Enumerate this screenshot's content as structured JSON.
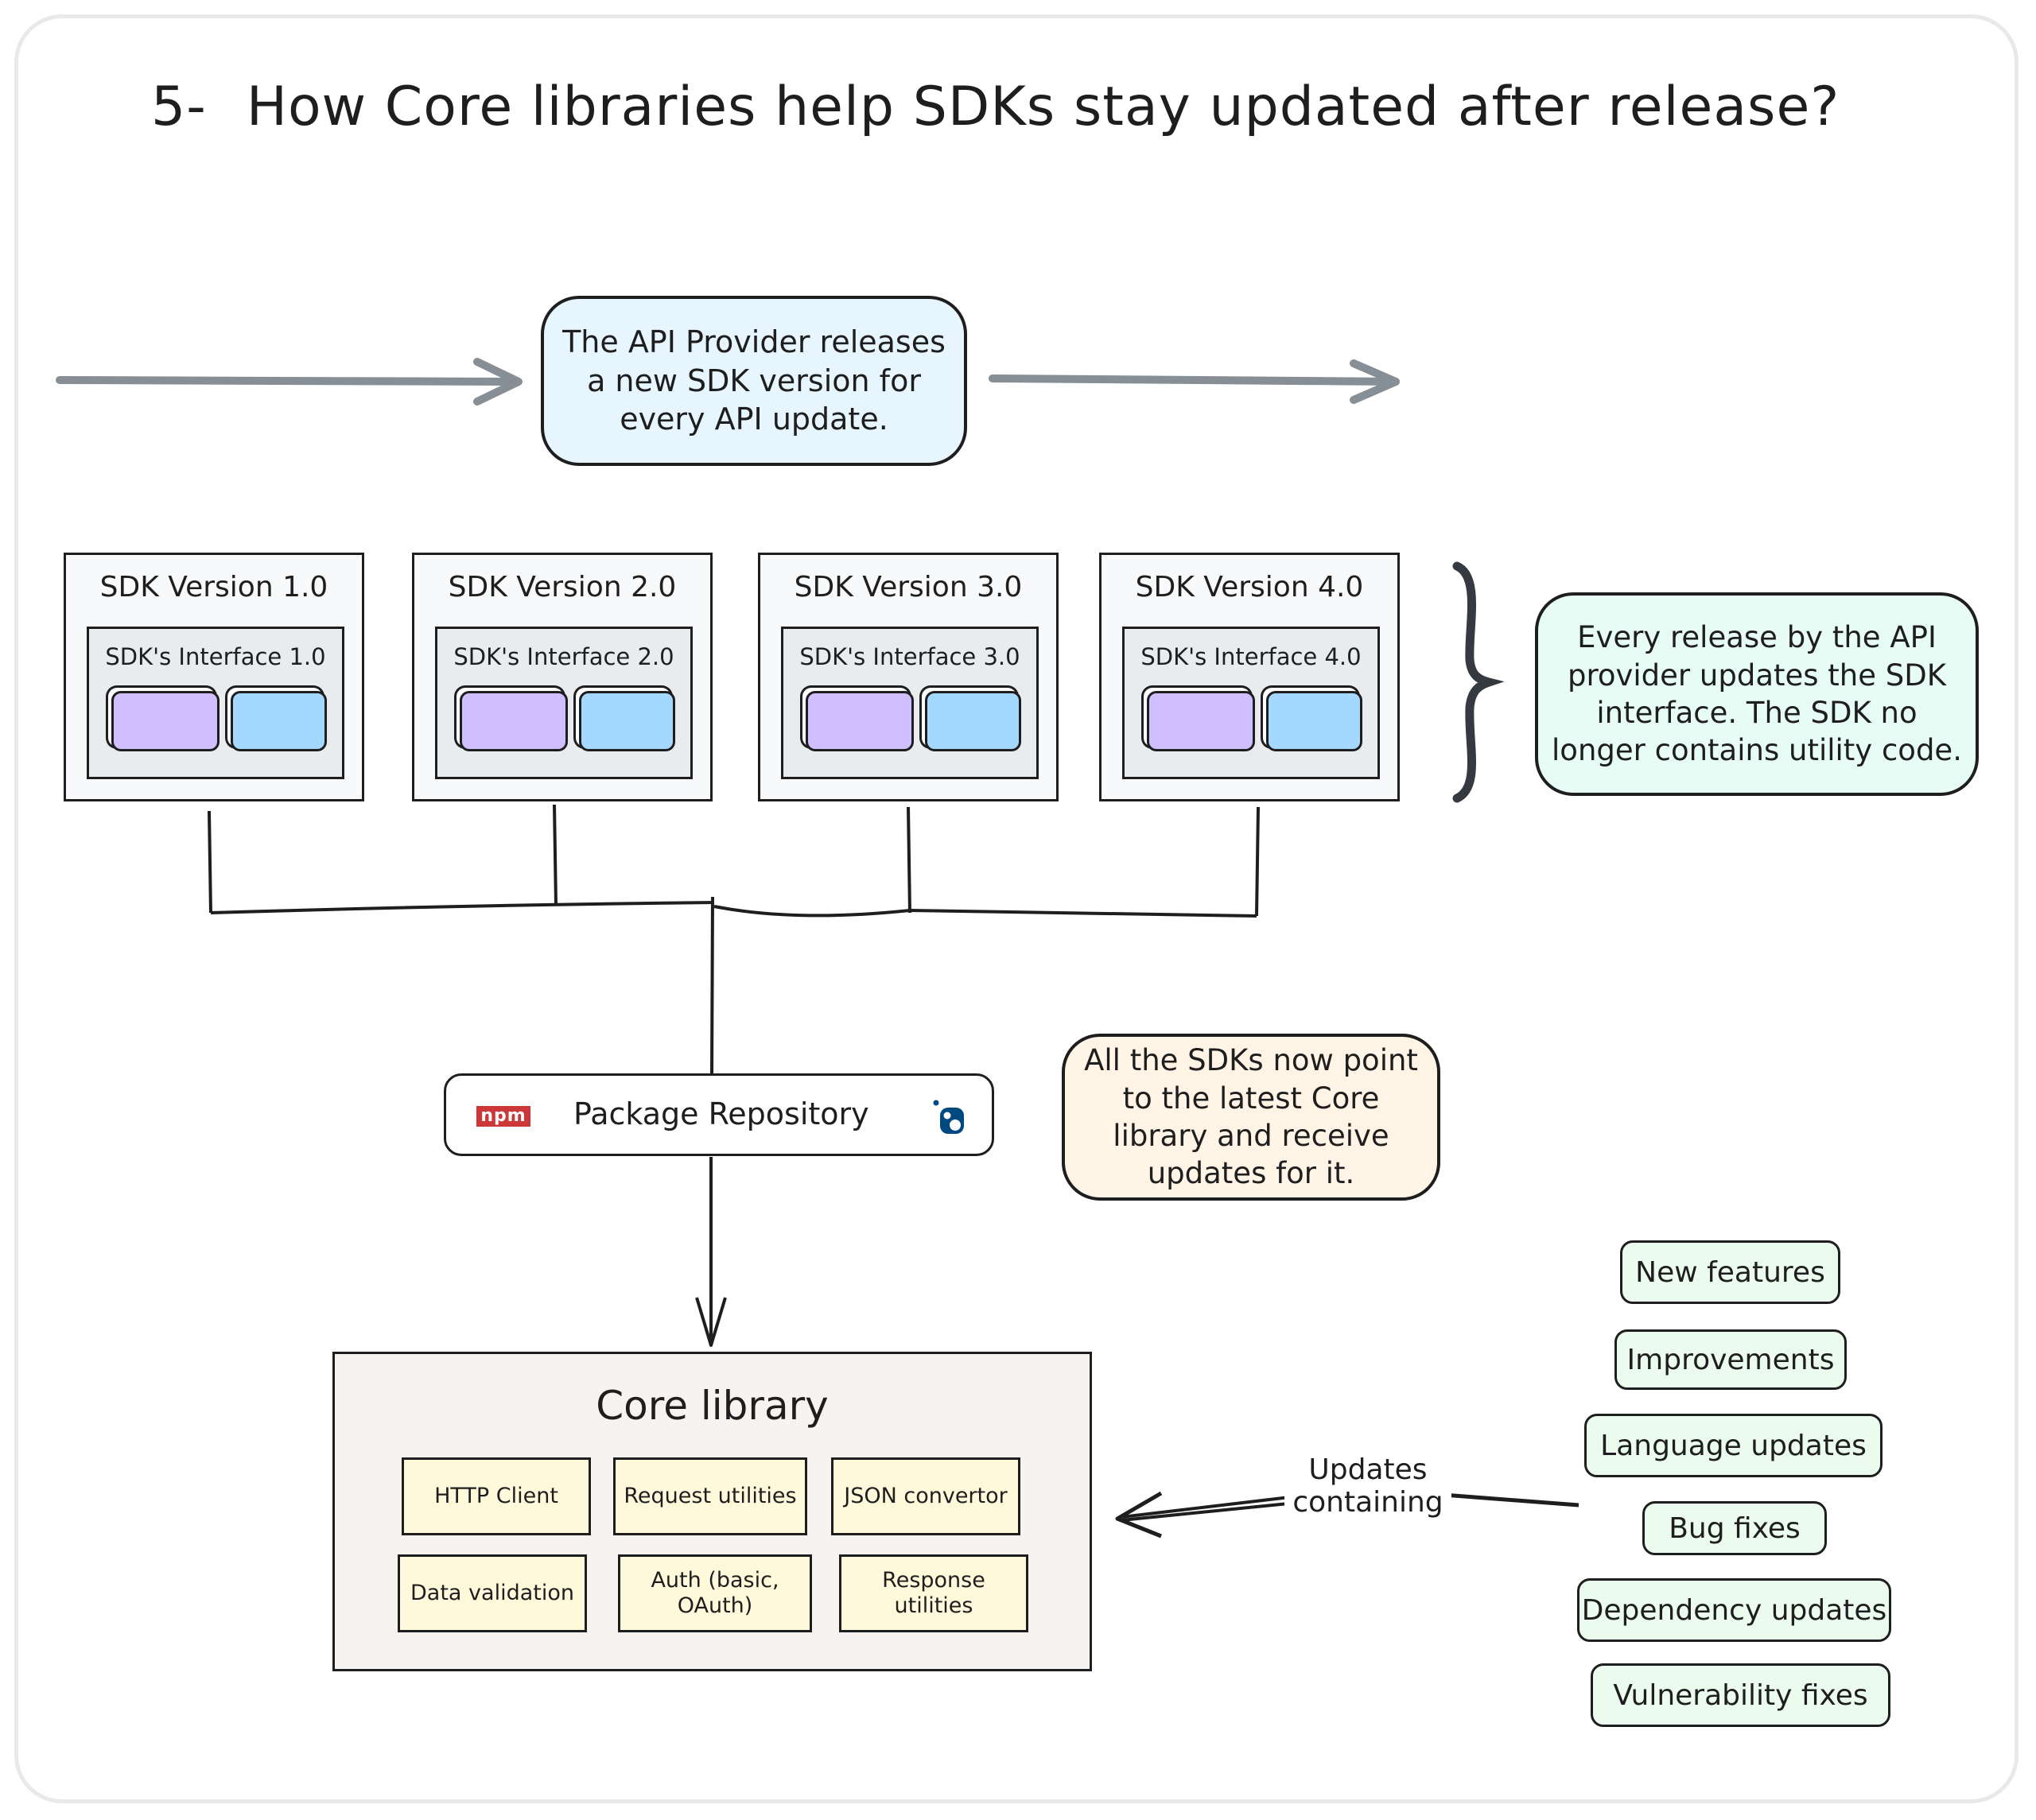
{
  "title": {
    "number": "5-",
    "text": "How Core libraries help SDKs stay updated after release?"
  },
  "release_note": "The API Provider releases a new SDK version for every API update.",
  "sdk_versions": [
    {
      "title": "SDK Version 1.0",
      "interface": "SDK's Interface 1.0"
    },
    {
      "title": "SDK Version 2.0",
      "interface": "SDK's Interface 2.0"
    },
    {
      "title": "SDK Version 3.0",
      "interface": "SDK's Interface 3.0"
    },
    {
      "title": "SDK Version 4.0",
      "interface": "SDK's Interface 4.0"
    }
  ],
  "interface_note": "Every release by the API provider updates the SDK interface. The SDK no longer contains utility code.",
  "package_repository": {
    "label": "Package Repository",
    "left_icon": "npm-logo-icon",
    "npm_text": "npm",
    "right_icon": "nuget-logo-icon"
  },
  "core_note": "All the SDKs now point to the latest Core library and receive updates for it.",
  "core_library": {
    "title": "Core library",
    "modules": [
      "HTTP Client",
      "Request utilities",
      "JSON convertor",
      "Data validation",
      "Auth (basic, OAuth)",
      "Response utilities"
    ]
  },
  "updates_label": "Updates containing",
  "update_types": [
    "New features",
    "Improvements",
    "Language updates",
    "Bug fixes",
    "Dependency updates",
    "Vulnerability fixes"
  ],
  "colors": {
    "release_note_bg": "#e7f5ff",
    "interface_note_bg": "#e6fcf5",
    "core_note_bg": "#fff4e6",
    "chip_purple": "#d0bfff",
    "chip_blue": "#a5d8ff",
    "module_bg": "#fff9db",
    "update_bg": "#ebfbee",
    "arrow_gray": "#868e96",
    "npm_red": "#cb3837",
    "nuget_blue": "#004880"
  }
}
